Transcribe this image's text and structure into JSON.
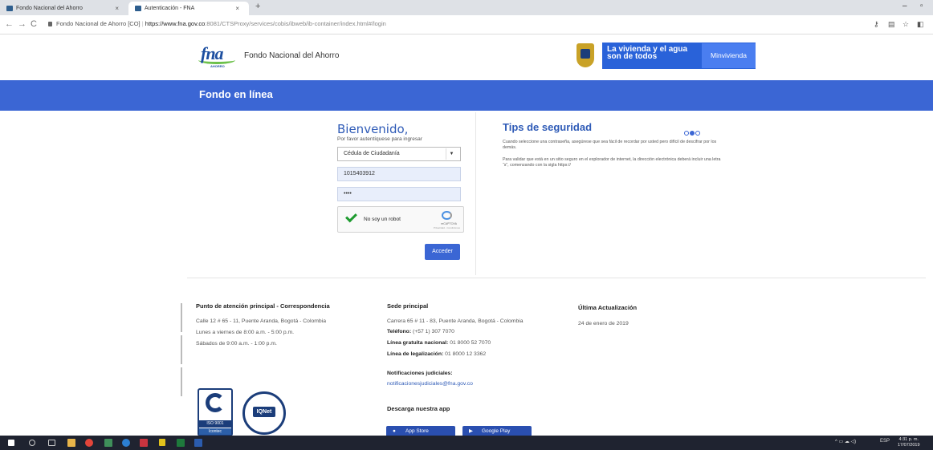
{
  "browser": {
    "tabs": [
      {
        "title": "Fondo Nacional del Ahorro"
      },
      {
        "title": "Autenticación - FNA"
      }
    ],
    "close_glyph": "×",
    "new_tab_glyph": "+",
    "minimize_glyph": "–",
    "maximize_glyph": "▫",
    "url_site": "Fondo Nacional de Ahorro [CO]",
    "url_host": "https://www.fna.gov.co",
    "url_path": ":8081/CTSProxy/services/cobis/ibweb/ib-container/index.html#/login"
  },
  "header": {
    "logo_text": "fna",
    "logo_sub": "AHORRO",
    "org_name": "Fondo Nacional del Ahorro",
    "gov_slogan": "La vivienda y el agua son de todos",
    "ministry": "Minvivienda"
  },
  "band": {
    "title": "Fondo en línea"
  },
  "login": {
    "welcome": "Bienvenido,",
    "subtitle": "Por favor autentíquese para ingresar",
    "doc_type": "Cédula de Ciudadanía",
    "doc_number": "1015403912",
    "password_mask": "••••",
    "captcha_label": "No soy un robot",
    "captcha_brand": "reCAPTCHA",
    "captcha_links": "Privacidad - Condiciones",
    "submit": "Acceder"
  },
  "tips": {
    "title": "Tips de seguridad",
    "p1": "Cuando seleccione una contraseña, asegúrese que sea fácil de recordar por usted pero difícil de descifrar por los demás.",
    "p2": "Para validar que está en un sitio seguro en el explorador de internet, la dirección electrónica deberá incluir una letra “s”, comenzando con la sigla https://"
  },
  "footer": {
    "col1": {
      "heading": "Punto de atención principal - Correspondencia",
      "lines": [
        "Calle 12 # 65 - 11, Puente Aranda, Bogotá - Colombia",
        "Lunes a viernes de 8:00 a.m. - 5:00 p.m.",
        "Sábados de 9:00 a.m. - 1:00 p.m."
      ]
    },
    "col2": {
      "heading": "Sede principal",
      "address": "Carrera 65 # 11 - 83, Puente Aranda, Bogotá - Colombia",
      "phone_label": "Teléfono:",
      "phone": "(+57 1) 307 7070",
      "toll_label": "Línea gratuita nacional:",
      "toll": "01 8000 52 7070",
      "legal_label": "Línea de legalización:",
      "legal": "01 8000 12 3362",
      "notif_heading": "Notificaciones judiciales:",
      "notif_email": "notificacionesjudiciales@fna.gov.co",
      "app_heading": "Descarga nuestra app",
      "app_store": "App Store",
      "google_play": "Google Play"
    },
    "col3": {
      "heading": "Última Actualización",
      "date": "24 de enero de 2019"
    },
    "iso": "ISO 9001",
    "icontec": "Icontec",
    "iqnet": "IQNet"
  },
  "taskbar": {
    "lang": "ESP",
    "time": "4:31 p. m.",
    "date": "17/07/2019"
  }
}
